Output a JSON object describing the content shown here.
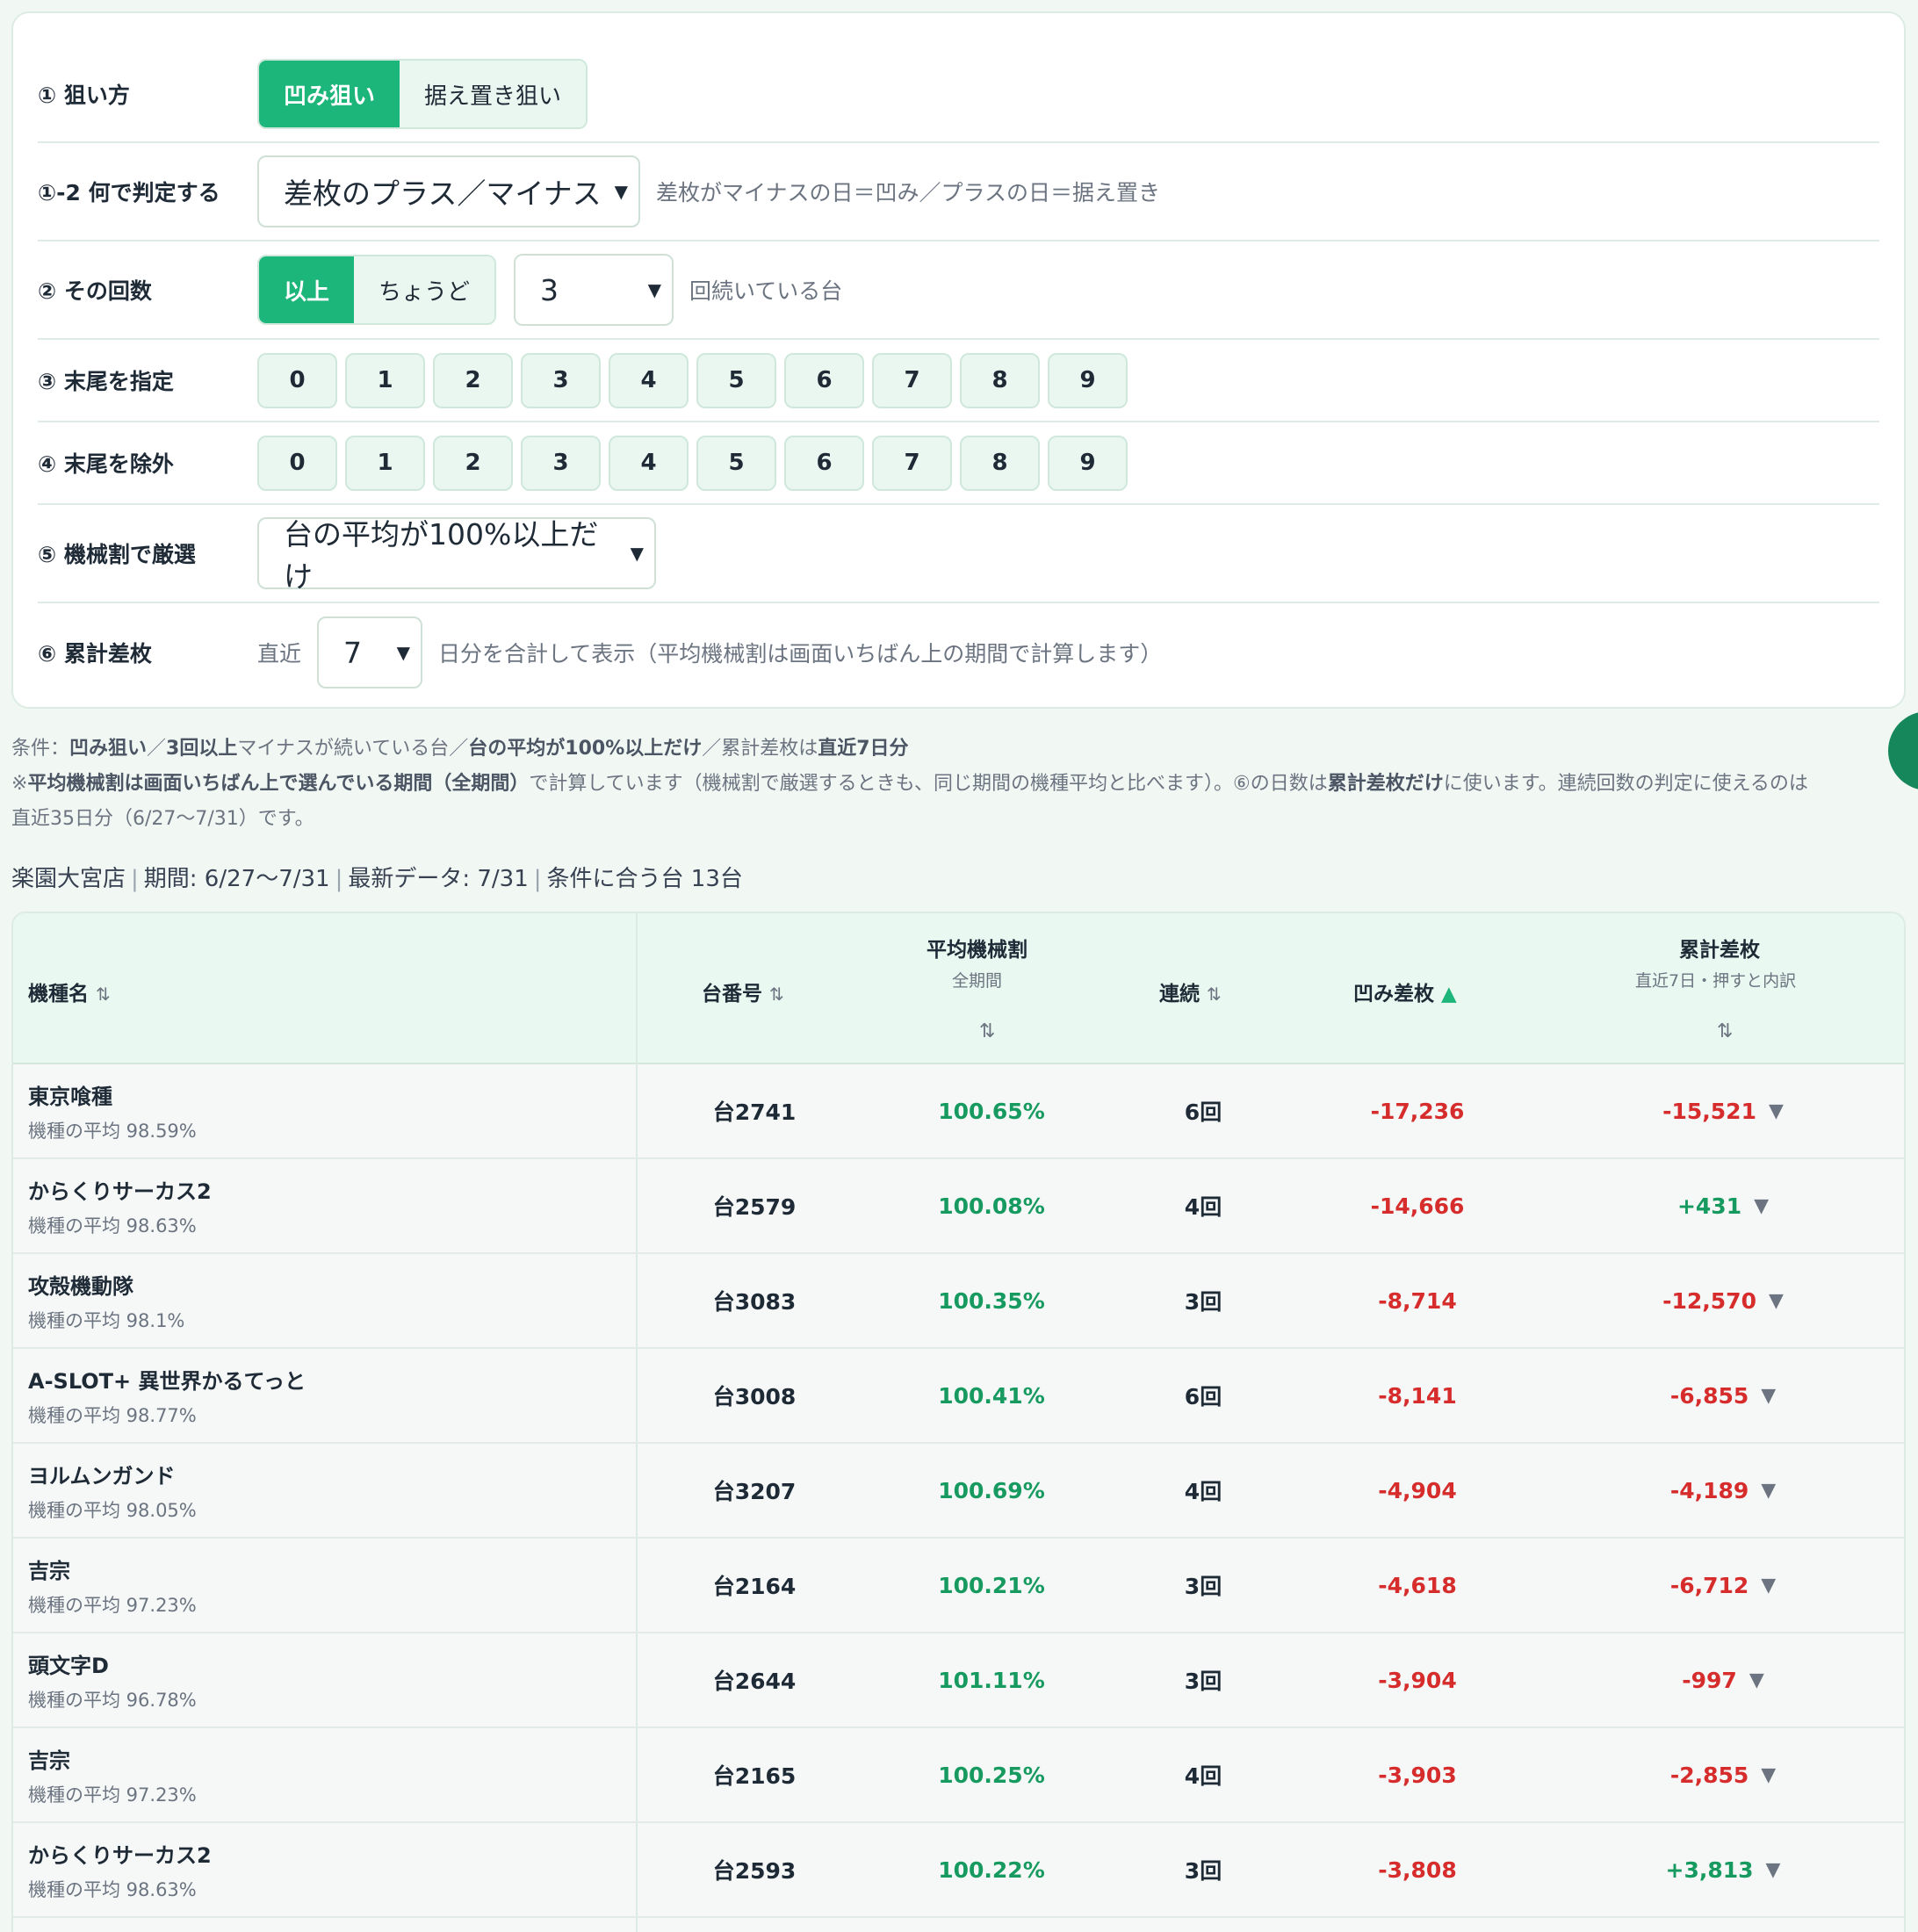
{
  "filters": {
    "aim": {
      "label": "① 狙い方",
      "options": [
        "凹み狙い",
        "据え置き狙い"
      ],
      "active": 0
    },
    "judge": {
      "label": "①-2 何で判定する",
      "value": "差枚のプラス／マイナス",
      "hint": "差枚がマイナスの日＝凹み／プラスの日＝据え置き"
    },
    "count": {
      "label": "② その回数",
      "options": [
        "以上",
        "ちょうど"
      ],
      "active": 0,
      "value": "3",
      "hint": "回続いている台"
    },
    "tail_include": {
      "label": "③ 末尾を指定",
      "digits": [
        "0",
        "1",
        "2",
        "3",
        "4",
        "5",
        "6",
        "7",
        "8",
        "9"
      ]
    },
    "tail_exclude": {
      "label": "④ 末尾を除外",
      "digits": [
        "0",
        "1",
        "2",
        "3",
        "4",
        "5",
        "6",
        "7",
        "8",
        "9"
      ]
    },
    "rate": {
      "label": "⑤ 機械割で厳選",
      "value": "台の平均が100%以上だけ"
    },
    "cumulative": {
      "label": "⑥ 累計差枚",
      "prefix": "直近",
      "value": "7",
      "hint": "日分を合計して表示（平均機械割は画面いちばん上の期間で計算します）"
    }
  },
  "conditions": {
    "l1": [
      "条件：",
      "凹み狙い",
      "／",
      "3回以上",
      "マイナスが続いている台／",
      "台の平均が100%以上だけ",
      "／累計差枚は",
      "直近7日分"
    ],
    "l2": [
      "※",
      "平均機械割は画面いちばん上で選んでいる期間（全期間）",
      "で計算しています（機械割で厳選するときも、同じ期間の機種平均と比べます）。⑥の日数は",
      "累計差枚だけ",
      "に使います。連続回数の判定に使えるのは"
    ],
    "l3": "直近35日分（6/27〜7/31）です。"
  },
  "meta": [
    "楽園大宮店",
    "期間: 6/27〜7/31",
    "最新データ: 7/31",
    "条件に合う台 13台"
  ],
  "table": {
    "headers": {
      "name": "機種名",
      "no": "台番号",
      "rate": "平均機械割",
      "rate_sub": "全期間",
      "ren": "連続",
      "diff": "凹み差枚",
      "cum": "累計差枚",
      "cum_sub": "直近7日・押すと内訳",
      "sort_icon": "⇅",
      "sorted_icon": "▲"
    },
    "rows": [
      {
        "name": "東京喰種",
        "avg": "機種の平均 98.59%",
        "no": "台2741",
        "rate": "100.65%",
        "ren": "6回",
        "diff": "-17,236",
        "cum": "-15,521",
        "cum_sign": "neg"
      },
      {
        "name": "からくりサーカス2",
        "avg": "機種の平均 98.63%",
        "no": "台2579",
        "rate": "100.08%",
        "ren": "4回",
        "diff": "-14,666",
        "cum": "+431",
        "cum_sign": "pos"
      },
      {
        "name": "攻殻機動隊",
        "avg": "機種の平均 98.1%",
        "no": "台3083",
        "rate": "100.35%",
        "ren": "3回",
        "diff": "-8,714",
        "cum": "-12,570",
        "cum_sign": "neg"
      },
      {
        "name": "A‐SLOT+ 異世界かるてっと",
        "avg": "機種の平均 98.77%",
        "no": "台3008",
        "rate": "100.41%",
        "ren": "6回",
        "diff": "-8,141",
        "cum": "-6,855",
        "cum_sign": "neg"
      },
      {
        "name": "ヨルムンガンド",
        "avg": "機種の平均 98.05%",
        "no": "台3207",
        "rate": "100.69%",
        "ren": "4回",
        "diff": "-4,904",
        "cum": "-4,189",
        "cum_sign": "neg"
      },
      {
        "name": "吉宗",
        "avg": "機種の平均 97.23%",
        "no": "台2164",
        "rate": "100.21%",
        "ren": "3回",
        "diff": "-4,618",
        "cum": "-6,712",
        "cum_sign": "neg"
      },
      {
        "name": "頭文字D",
        "avg": "機種の平均 96.78%",
        "no": "台2644",
        "rate": "101.11%",
        "ren": "3回",
        "diff": "-3,904",
        "cum": "-997",
        "cum_sign": "neg"
      },
      {
        "name": "吉宗",
        "avg": "機種の平均 97.23%",
        "no": "台2165",
        "rate": "100.25%",
        "ren": "4回",
        "diff": "-3,903",
        "cum": "-2,855",
        "cum_sign": "neg"
      },
      {
        "name": "からくりサーカス2",
        "avg": "機種の平均 98.63%",
        "no": "台2593",
        "rate": "100.22%",
        "ren": "3回",
        "diff": "-3,808",
        "cum": "+3,813",
        "cum_sign": "pos"
      }
    ]
  },
  "colors": {
    "accent": "#1cb57a",
    "positive": "#169a5f",
    "negative": "#d62c2c"
  }
}
